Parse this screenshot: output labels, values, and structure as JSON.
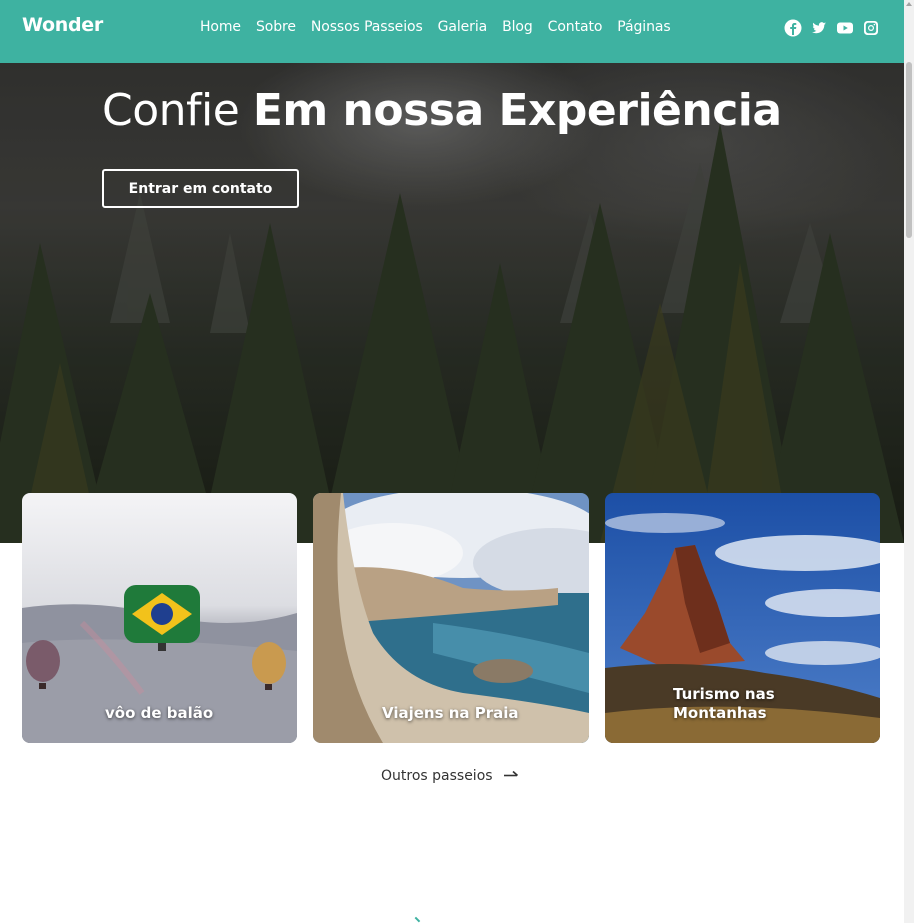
{
  "header": {
    "brand": "Wonder",
    "nav": [
      "Home",
      "Sobre",
      "Nossos Passeios",
      "Galeria",
      "Blog",
      "Contato",
      "Páginas"
    ],
    "social_icons": [
      "facebook-icon",
      "twitter-icon",
      "youtube-icon",
      "instagram-icon"
    ]
  },
  "hero": {
    "title_light": "Confie",
    "title_bold": "Em nossa Experiência",
    "cta_label": "Entrar em contato"
  },
  "cards": [
    {
      "title": "vôo de balão"
    },
    {
      "title": "Viajens na Praia"
    },
    {
      "title_line1": "Turismo nas",
      "title_line2": "Montanhas"
    }
  ],
  "more_link": "Outros passeios",
  "colors": {
    "accent": "#3eb2a1",
    "white": "#ffffff",
    "text": "#333333"
  }
}
